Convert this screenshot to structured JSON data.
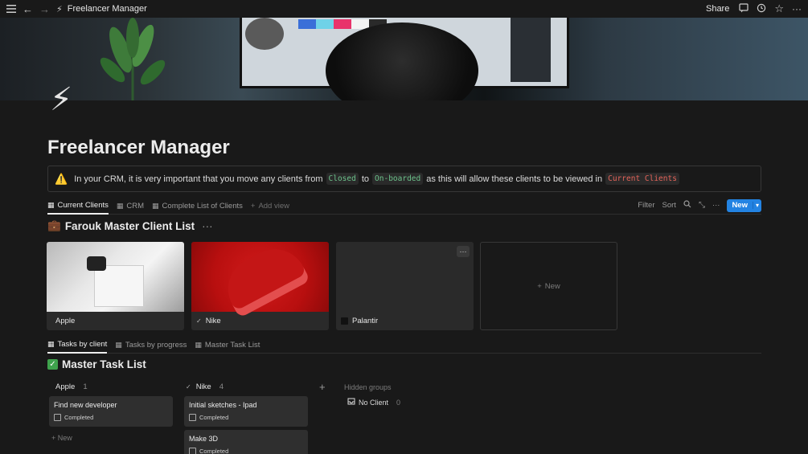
{
  "topbar": {
    "title": "Freelancer Manager",
    "share_label": "Share",
    "icons": [
      "menu-icon",
      "back-arrow-icon",
      "forward-arrow-icon",
      "lightning-icon",
      "comment-icon",
      "history-icon",
      "star-icon",
      "more-icon"
    ]
  },
  "page": {
    "icon": "⚡",
    "title": "Freelancer Manager"
  },
  "callout": {
    "icon": "⚠️",
    "text_1": "In your CRM, it is very important that you move any clients from",
    "code_1": "Closed",
    "text_2": "to",
    "code_2": "On-boarded",
    "text_3": "as this will allow these clients to be viewed in",
    "code_3": "Current Clients"
  },
  "views_1": {
    "tabs": [
      {
        "label": "Current Clients",
        "active": true
      },
      {
        "label": "CRM",
        "active": false
      },
      {
        "label": "Complete List of Clients",
        "active": false
      }
    ],
    "add_view": "Add view",
    "filter": "Filter",
    "sort": "Sort",
    "new_button": "New"
  },
  "client_list": {
    "icon": "💼",
    "title": "Farouk Master Client List",
    "cards": [
      {
        "name": "Apple"
      },
      {
        "name": "Nike"
      },
      {
        "name": "Palantir"
      }
    ],
    "new_label": "New"
  },
  "views_2": {
    "tabs": [
      {
        "label": "Tasks by client",
        "active": true
      },
      {
        "label": "Tasks by progress",
        "active": false
      },
      {
        "label": "Master Task List",
        "active": false
      }
    ]
  },
  "task_list": {
    "title": "Master Task List",
    "columns": [
      {
        "name": "Apple",
        "count": "1",
        "tasks": [
          {
            "title": "Find new developer",
            "status": "Completed"
          }
        ],
        "new_label": "New"
      },
      {
        "name": "Nike",
        "count": "4",
        "tasks": [
          {
            "title": "Initial sketches - Ipad",
            "status": "Completed"
          },
          {
            "title": "Make 3D",
            "status": "Completed"
          }
        ]
      }
    ],
    "hidden_groups": "Hidden groups",
    "no_client": "No Client",
    "no_client_count": "0"
  }
}
